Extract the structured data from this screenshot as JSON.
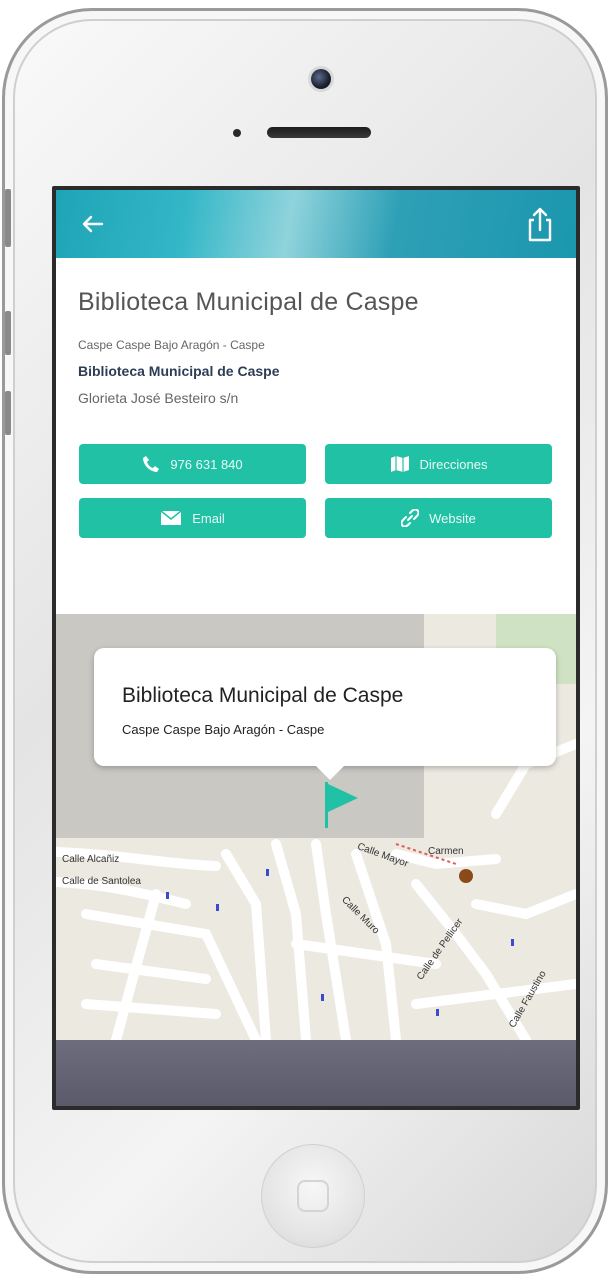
{
  "header": {
    "back_icon": "arrow-left-icon",
    "share_icon": "share-icon"
  },
  "place": {
    "title": "Biblioteca Municipal de Caspe",
    "location": "Caspe Caspe Bajo Aragón - Caspe",
    "name": "Biblioteca Municipal de Caspe",
    "address": "Glorieta José Besteiro s/n"
  },
  "actions": {
    "phone_label": "976 631 840",
    "directions_label": "Direcciones",
    "email_label": "Email",
    "website_label": "Website"
  },
  "map": {
    "callout_title": "Biblioteca Municipal de Caspe",
    "callout_subtitle": "Caspe Caspe Bajo Aragón - Caspe",
    "streets": [
      "Calle Alcañiz",
      "Calle de Santolea",
      "Calle Mayor",
      "Carmen",
      "Calle Muro",
      "Calle de Pellicer",
      "Calle Faustino"
    ]
  },
  "colors": {
    "accent": "#21c1a6",
    "appbar": "#1ea4b6"
  }
}
